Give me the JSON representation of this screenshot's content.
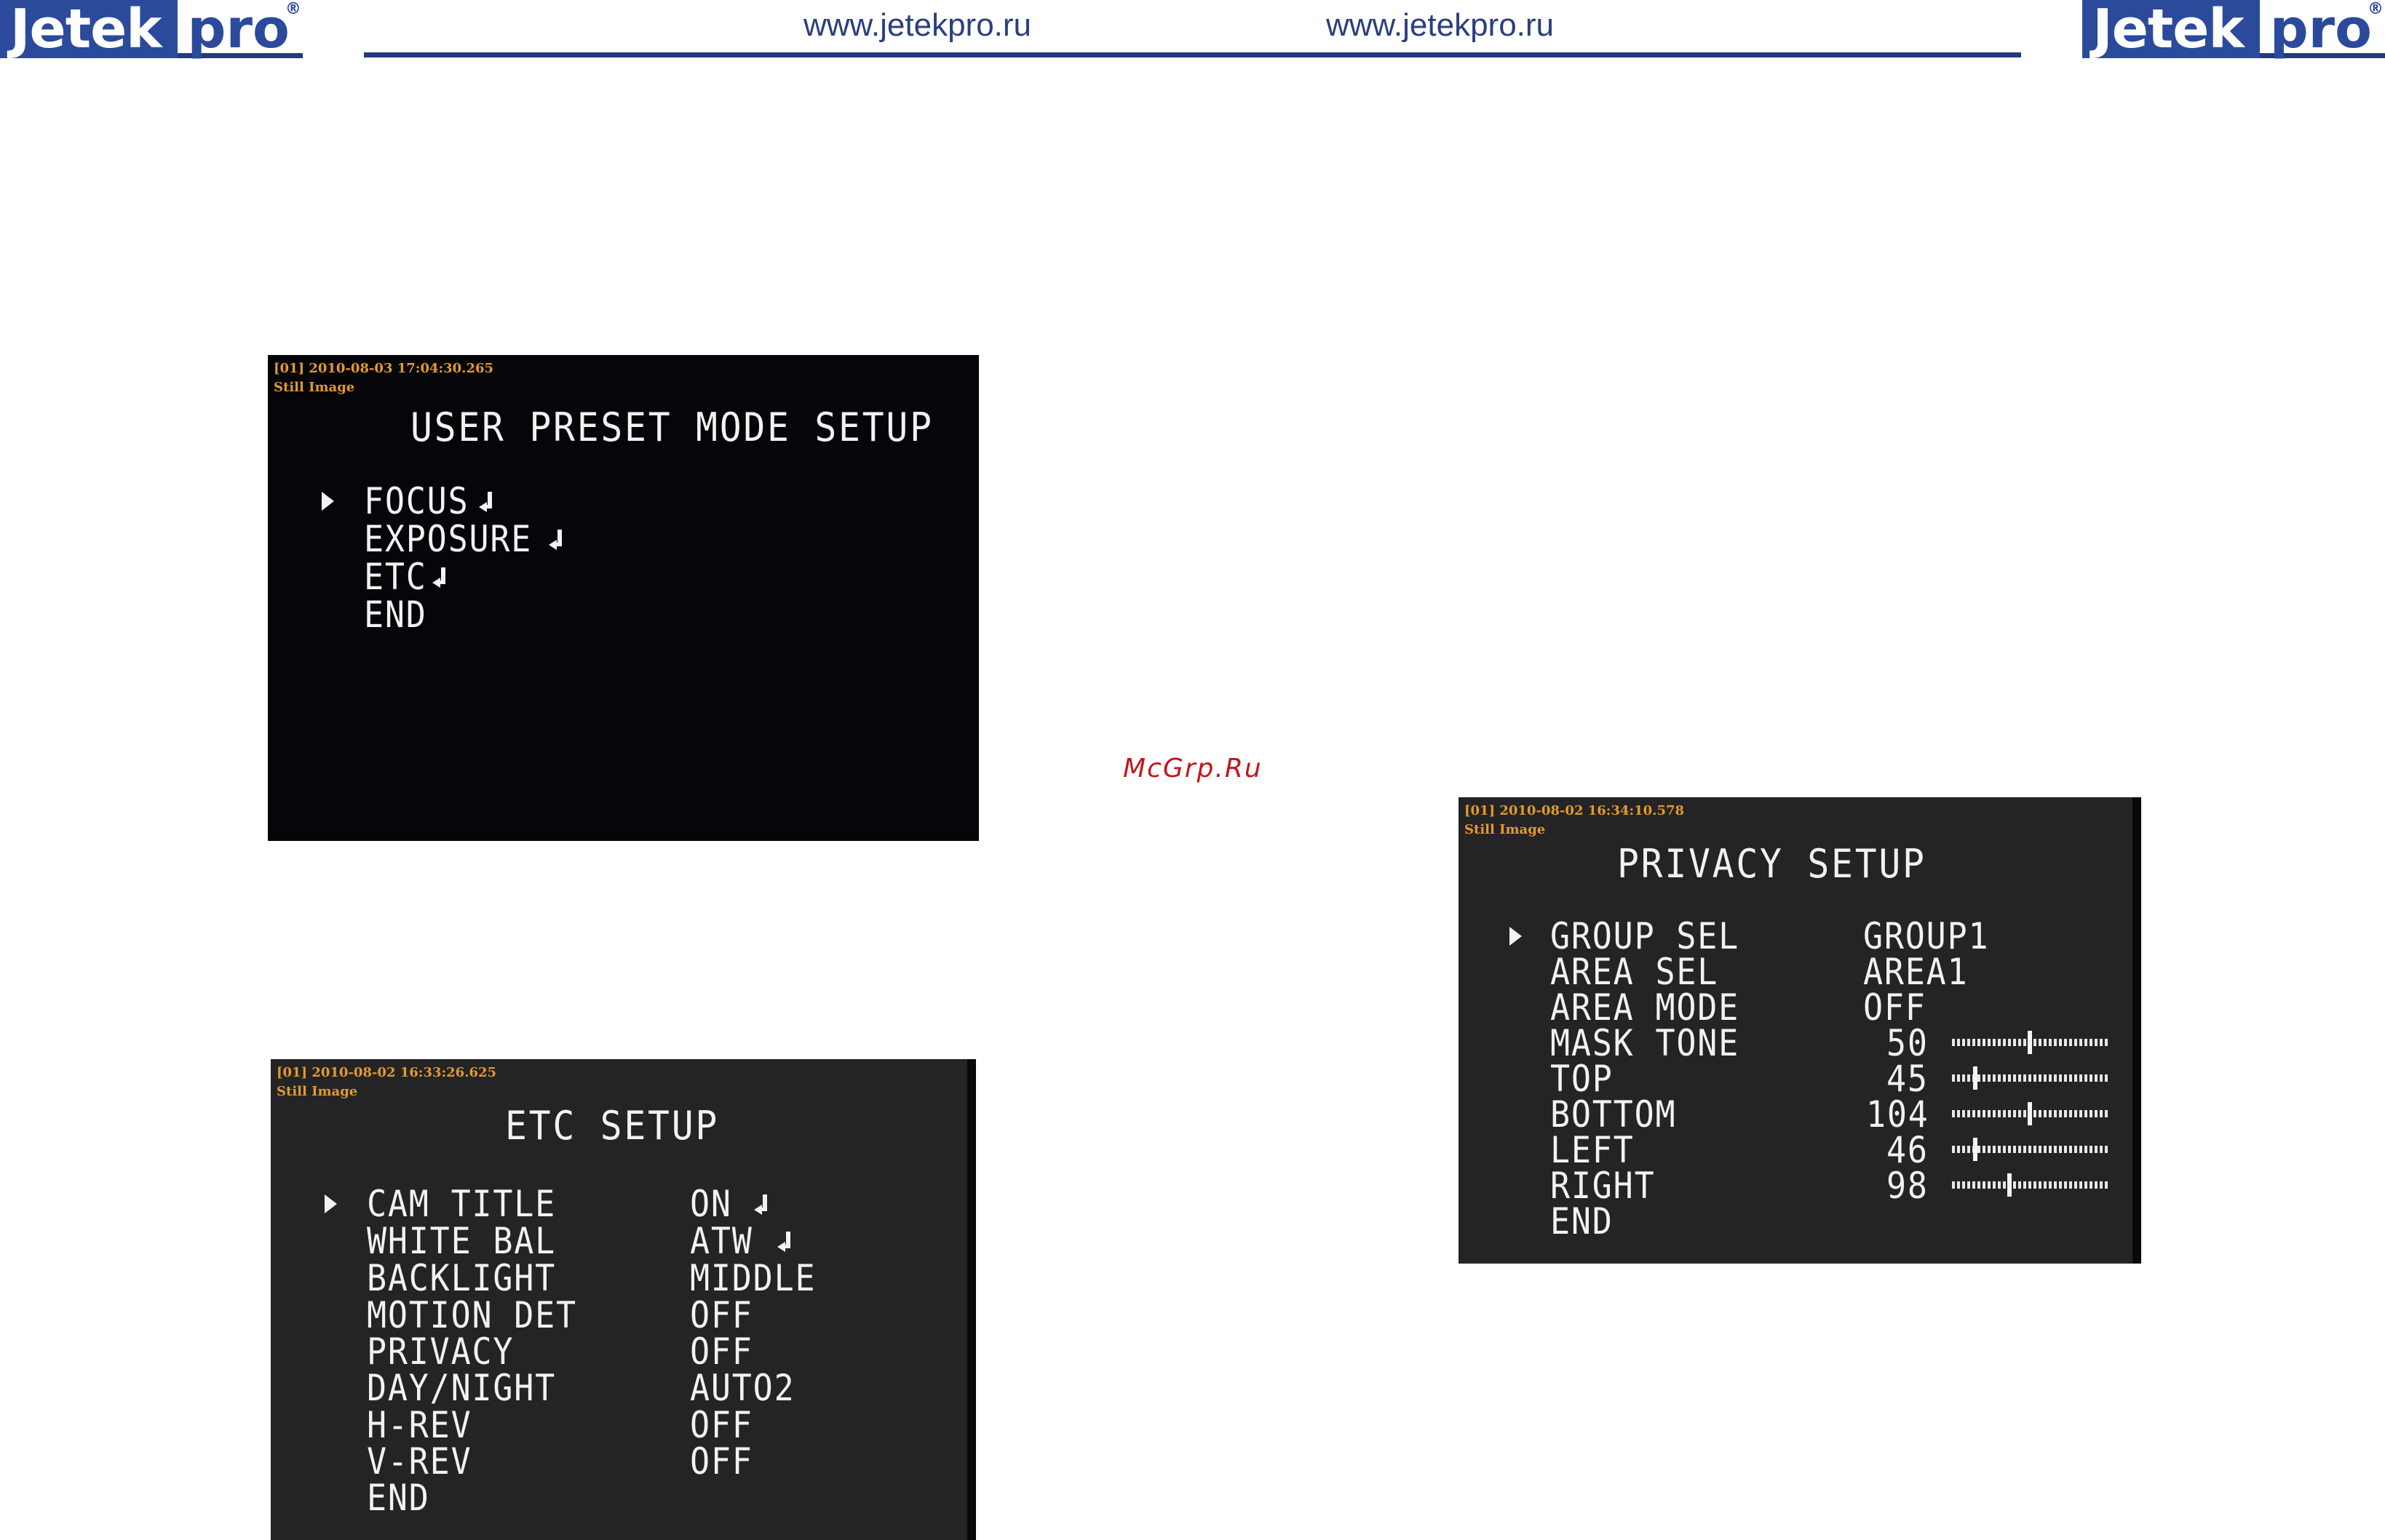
{
  "header": {
    "logo_left": {
      "jetek": "Jetek",
      "pro": "pro",
      "reg": "®"
    },
    "logo_right": {
      "jetek": "Jetek",
      "pro": "pro",
      "reg": "®"
    },
    "url_1": "www.jetekpro.ru",
    "url_2": "www.jetekpro.ru"
  },
  "watermark": "McGrp.Ru",
  "screens": {
    "user_preset": {
      "timestamp": "[01] 2010-08-03 17:04:30.265",
      "still": "Still Image",
      "title": "USER PRESET MODE SETUP",
      "items": [
        "FOCUS",
        "EXPOSURE",
        "ETC",
        "END"
      ]
    },
    "etc_setup": {
      "timestamp": "[01] 2010-08-02 16:33:26.625",
      "still": "Still Image",
      "title": "ETC SETUP",
      "items": [
        {
          "label": "CAM TITLE",
          "value": "ON"
        },
        {
          "label": "WHITE BAL",
          "value": "ATW"
        },
        {
          "label": "BACKLIGHT",
          "value": "MIDDLE"
        },
        {
          "label": "MOTION DET",
          "value": "OFF"
        },
        {
          "label": "PRIVACY",
          "value": "OFF"
        },
        {
          "label": "DAY/NIGHT",
          "value": "AUTO2"
        },
        {
          "label": "H-REV",
          "value": "OFF"
        },
        {
          "label": "V-REV",
          "value": "OFF"
        },
        {
          "label": "END",
          "value": ""
        }
      ]
    },
    "privacy_setup": {
      "timestamp": "[01] 2010-08-02 16:34:10.578",
      "still": "Still Image",
      "title": "PRIVACY SETUP",
      "items": [
        {
          "label": "GROUP SEL",
          "value": "GROUP1"
        },
        {
          "label": "AREA SEL",
          "value": "AREA1"
        },
        {
          "label": "AREA MODE",
          "value": "OFF"
        },
        {
          "label": "MASK TONE",
          "value": "50",
          "level": 0.5
        },
        {
          "label": "TOP",
          "value": "45",
          "level": 0.15
        },
        {
          "label": "BOTTOM",
          "value": "104",
          "level": 0.5
        },
        {
          "label": "LEFT",
          "value": "46",
          "level": 0.15
        },
        {
          "label": "RIGHT",
          "value": "98",
          "level": 0.37
        },
        {
          "label": "END",
          "value": ""
        }
      ]
    }
  },
  "colors": {
    "brand_blue": "#2b4a9c",
    "osd_text": "#f2f2f2",
    "timestamp": "#e39a2a",
    "watermark": "#c2161d"
  }
}
